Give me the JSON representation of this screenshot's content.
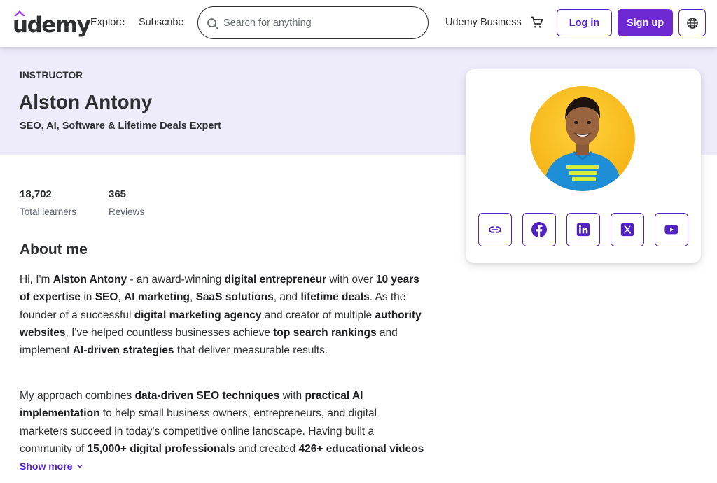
{
  "header": {
    "logo_text": "udemy",
    "nav": {
      "explore": "Explore",
      "subscribe": "Subscribe",
      "business": "Udemy Business"
    },
    "search": {
      "placeholder": "Search for anything"
    },
    "login_label": "Log in",
    "signup_label": "Sign up",
    "icons": {
      "search": "search-icon",
      "cart": "cart-icon",
      "globe": "globe-icon"
    }
  },
  "instructor": {
    "eyebrow": "INSTRUCTOR",
    "name": "Alston Antony",
    "headline": "SEO, AI, Software & Lifetime Deals Expert"
  },
  "stats": [
    {
      "value": "18,702",
      "label": "Total learners"
    },
    {
      "value": "365",
      "label": "Reviews"
    }
  ],
  "about": {
    "title": "About me",
    "paragraph1": [
      {
        "t": "Hi, I'm "
      },
      {
        "t": "Alston Antony",
        "b": true
      },
      {
        "t": " - an award-winning "
      },
      {
        "t": "digital entrepreneur",
        "b": true
      },
      {
        "t": " with over "
      },
      {
        "t": "10 years of expertise",
        "b": true
      },
      {
        "t": " in "
      },
      {
        "t": "SEO",
        "b": true
      },
      {
        "t": ", "
      },
      {
        "t": "AI marketing",
        "b": true
      },
      {
        "t": ", "
      },
      {
        "t": "SaaS solutions",
        "b": true
      },
      {
        "t": ", and "
      },
      {
        "t": "lifetime deals",
        "b": true
      },
      {
        "t": ". As the founder of a successful "
      },
      {
        "t": "digital marketing agency",
        "b": true
      },
      {
        "t": " and creator of multiple "
      },
      {
        "t": "authority websites",
        "b": true
      },
      {
        "t": ", I've helped countless businesses achieve "
      },
      {
        "t": "top search rankings",
        "b": true
      },
      {
        "t": " and implement "
      },
      {
        "t": "AI-driven strategies",
        "b": true
      },
      {
        "t": " that deliver measurable results."
      }
    ],
    "paragraph2": [
      {
        "t": "My approach combines "
      },
      {
        "t": "data-driven SEO techniques",
        "b": true
      },
      {
        "t": " with "
      },
      {
        "t": "practical AI implementation",
        "b": true
      },
      {
        "t": " to help small business owners, entrepreneurs, and digital marketers succeed in today's competitive online landscape. Having built a community of "
      },
      {
        "t": "15,000+ digital professionals",
        "b": true
      },
      {
        "t": " and created "
      },
      {
        "t": "426+ educational videos",
        "b": true
      }
    ],
    "show_more": "Show more"
  },
  "profile_card": {
    "avatar_alt": "avatar",
    "socials": [
      "link-icon",
      "facebook-icon",
      "linkedin-icon",
      "x-icon",
      "youtube-icon"
    ]
  },
  "colors": {
    "brand": "#6d28d2",
    "brand_dark": "#5022c3",
    "banner": "#eeecfb",
    "text": "#2d2f31"
  }
}
